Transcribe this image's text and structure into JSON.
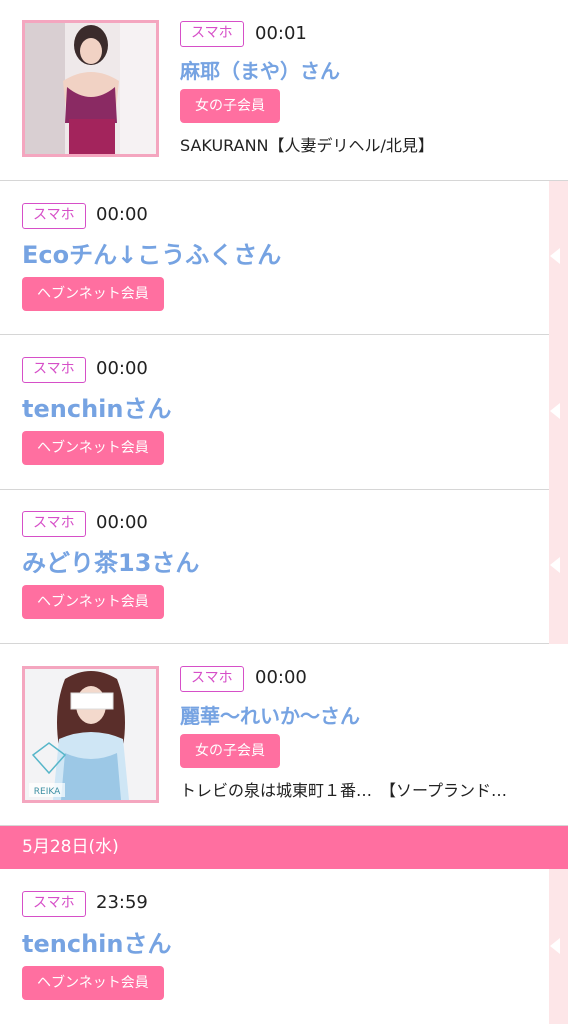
{
  "colors": {
    "accent_pink": "#ff6fa0",
    "device_badge": "#d64fc8",
    "name_blue": "#76a3e2",
    "strip_bg": "#fde6e8"
  },
  "entries": [
    {
      "device": "スマホ",
      "time": "00:01",
      "name": "麻耶（まや）さん",
      "member": "女の子会員",
      "shop": "SAKURANN【人妻デリヘル/北見】",
      "has_photo": true
    },
    {
      "device": "スマホ",
      "time": "00:00",
      "name": "Ecoチん↓こうふくさん",
      "member": "ヘブンネット会員",
      "has_photo": false
    },
    {
      "device": "スマホ",
      "time": "00:00",
      "name": "tenchinさん",
      "member": "ヘブンネット会員",
      "has_photo": false
    },
    {
      "device": "スマホ",
      "time": "00:00",
      "name": "みどり茶13さん",
      "member": "ヘブンネット会員",
      "has_photo": false
    },
    {
      "device": "スマホ",
      "time": "00:00",
      "name": "麗華〜れいか〜さん",
      "member": "女の子会員",
      "shop": "トレビの泉は城東町１番…　【ソープランド…",
      "photo_caption": "REIKA",
      "has_photo": true
    }
  ],
  "date_header": "5月28日(水)",
  "entries_after": [
    {
      "device": "スマホ",
      "time": "23:59",
      "name": "tenchinさん",
      "member": "ヘブンネット会員",
      "has_photo": false
    }
  ]
}
